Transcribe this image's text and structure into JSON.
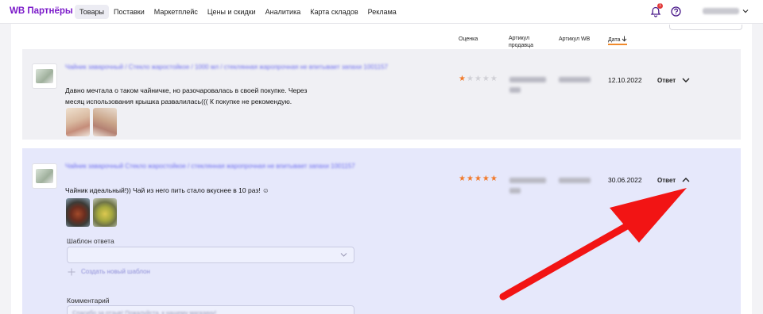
{
  "brand": "WB Партнёры",
  "nav": [
    {
      "label": "Товары",
      "active": true
    },
    {
      "label": "Поставки",
      "active": false
    },
    {
      "label": "Маркетплейс",
      "active": false
    },
    {
      "label": "Цены и скидки",
      "active": false
    },
    {
      "label": "Аналитика",
      "active": false
    },
    {
      "label": "Карта складов",
      "active": false
    },
    {
      "label": "Реклама",
      "active": false
    }
  ],
  "header_icons": {
    "notification_count": "1",
    "bell": "bell-icon",
    "help": "help-icon"
  },
  "table": {
    "columns": {
      "rating": "Оценка",
      "seller_article": "Артикул продавца",
      "wb_article": "Артикул WB",
      "date": "Дата"
    }
  },
  "reviews": [
    {
      "rating": 1,
      "text": "Давно мечтала о таком чайничке, но разочаровалась в своей покупке. Через месяц использования крышка развалилась((( К покупке не рекомендую.",
      "date": "12.10.2022",
      "answer_label": "Ответ",
      "expanded": false
    },
    {
      "rating": 5,
      "text": "Чайник идеальный!)) Чай из него пить стало вкуснее в 10 раз! ☺",
      "date": "30.06.2022",
      "answer_label": "Ответ",
      "expanded": true
    }
  ],
  "answer_form": {
    "template_label": "Шаблон ответа",
    "comment_label": "Комментарий"
  },
  "colors": {
    "brand": "#7a18c9",
    "star": "#f17a2b",
    "arrow": "#f21414",
    "expanded_row": "#e6e8fb"
  }
}
